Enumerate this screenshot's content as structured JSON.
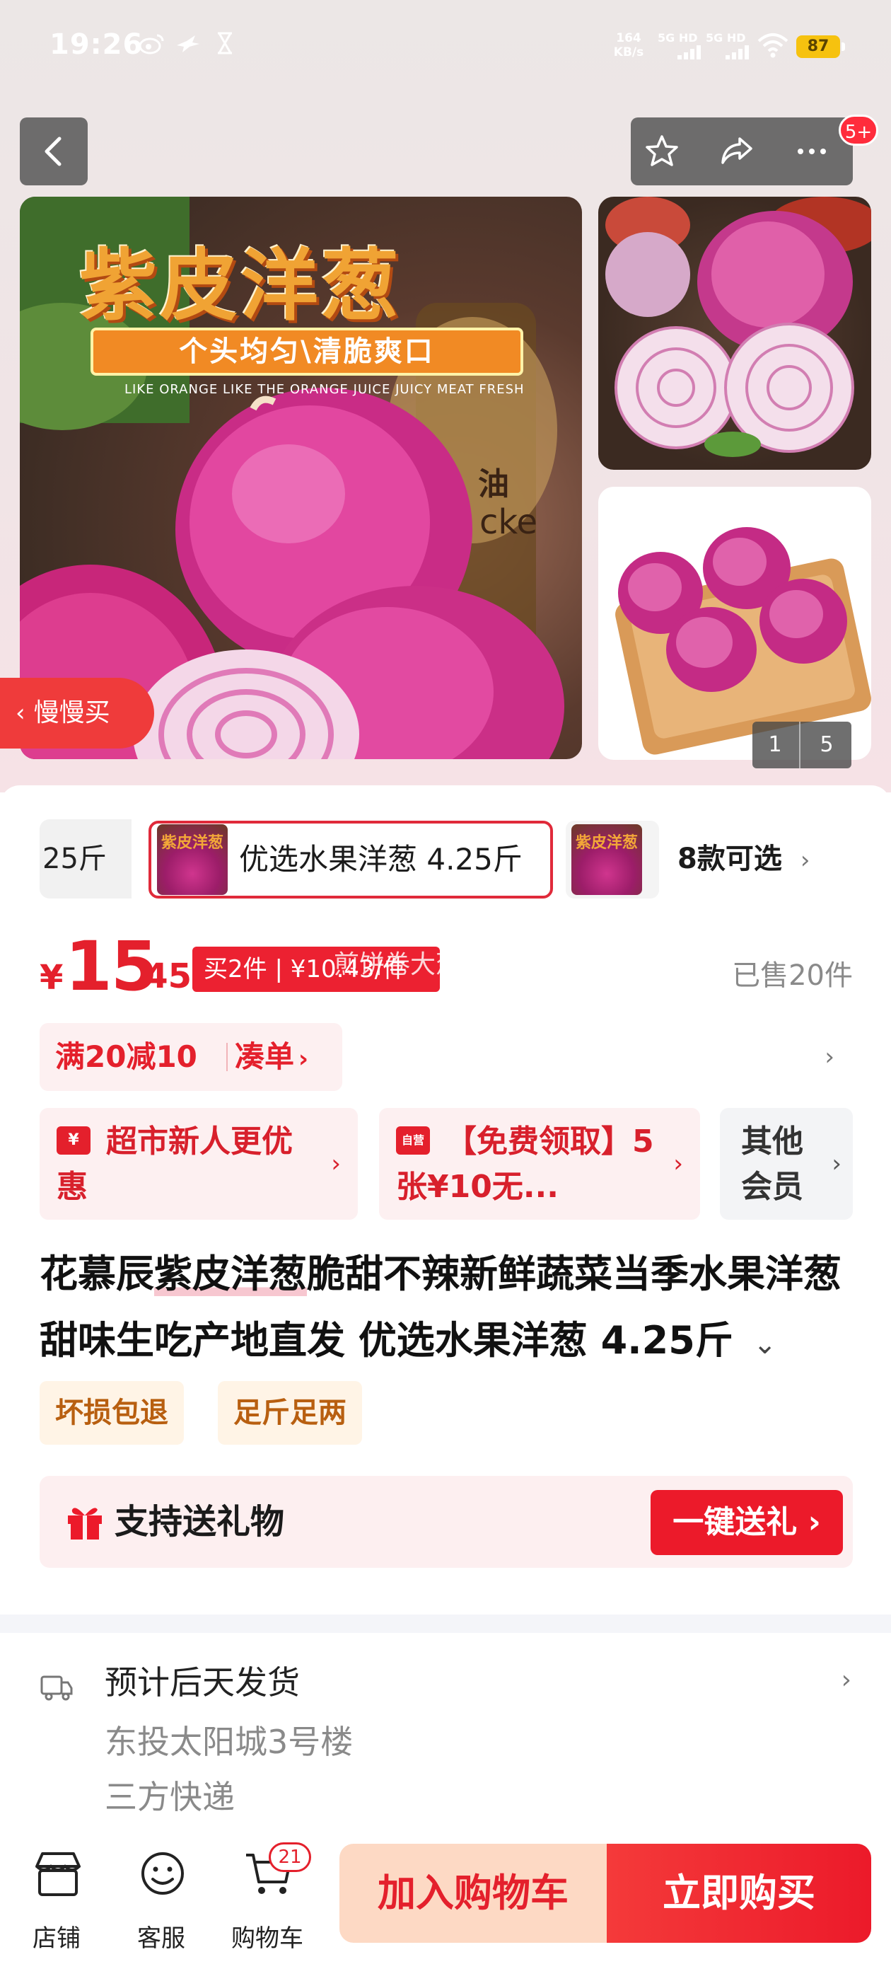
{
  "status_bar": {
    "time": "19:26",
    "net_speed_value": "164",
    "net_speed_unit": "KB/s",
    "signal_1_label": "5G HD",
    "signal_2_label": "5G HD",
    "battery_level": "87"
  },
  "header": {
    "message_badge": "5+"
  },
  "gallery": {
    "main_image": {
      "title": "紫皮洋葱",
      "ribbon": "个头均匀\\清脆爽口",
      "tagline": "LIKE ORANGE LIKE THE ORANGE JUICE JUICY MEAT FRESH"
    },
    "slow_buy_label": "慢慢买",
    "current_page": "1",
    "total_pages": "5"
  },
  "variants": {
    "previous_label": "25斤",
    "selected_label": "优选水果洋葱 4.25斤",
    "thumb_text": "紫皮洋葱",
    "count_label": "8款可选"
  },
  "price": {
    "currency": "¥",
    "integer": "15",
    "decimal": ".45",
    "bundle_tag": "买2件 | ¥10.43/件",
    "bundle_overlay": "煎饼卷大葱侠",
    "sold_count": "已售20件"
  },
  "promotion": {
    "discount": "满20减10",
    "action": "凑单"
  },
  "coupons": [
    {
      "icon": "¥",
      "text": "超市新人更优惠"
    },
    {
      "icon": "自营",
      "text": "【免费领取】5张¥10无..."
    },
    {
      "text": "其他会员"
    }
  ],
  "product": {
    "title_pre": "花慕辰",
    "title_highlight": "紫皮洋葱",
    "title_post": "脆甜不辣新鲜蔬菜当季水果洋葱甜味生吃产地直发 优选水果洋葱 4.25斤"
  },
  "service_tags": [
    "坏损包退",
    "足斤足两"
  ],
  "gift": {
    "label": "支持送礼物",
    "button": "一键送礼"
  },
  "shipping": {
    "estimate": "预计后天发货",
    "address": "东投太阳城3号楼",
    "courier": "三方快递"
  },
  "bottom_bar": {
    "store": "店铺",
    "service": "客服",
    "cart": "购物车",
    "cart_count": "21",
    "add_to_cart": "加入购物车",
    "buy_now": "立即购买"
  },
  "colors": {
    "accent_red": "#e4202c",
    "add_cart_bg": "#fdd9c4",
    "badge_yellow": "#f6c20f"
  }
}
